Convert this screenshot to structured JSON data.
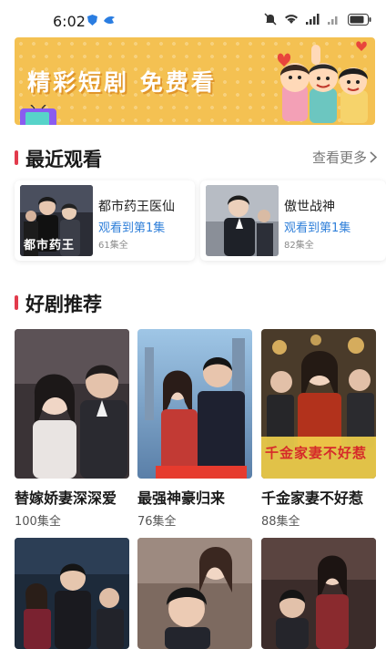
{
  "status_bar": {
    "time": "6:02"
  },
  "banner": {
    "text": "精彩短剧 免费看"
  },
  "recent": {
    "title": "最近观看",
    "more_label": "查看更多",
    "items": [
      {
        "title": "都市药王医仙",
        "progress": "观看到第1集",
        "count": "61集全",
        "poster_text": "都市药王"
      },
      {
        "title": "傲世战神",
        "progress": "观看到第1集",
        "count": "82集全"
      }
    ]
  },
  "recommend": {
    "title": "好剧推荐",
    "items": [
      {
        "title": "替嫁娇妻深深爱",
        "count": "100集全"
      },
      {
        "title": "最强神豪归来",
        "count": "76集全"
      },
      {
        "title": "千金家妻不好惹",
        "count": "88集全",
        "poster_text": "千金家妻不好惹"
      }
    ]
  },
  "colors": {
    "accent": "#e23b4c",
    "link_blue": "#2f7fd9",
    "banner": "#f4c152"
  }
}
